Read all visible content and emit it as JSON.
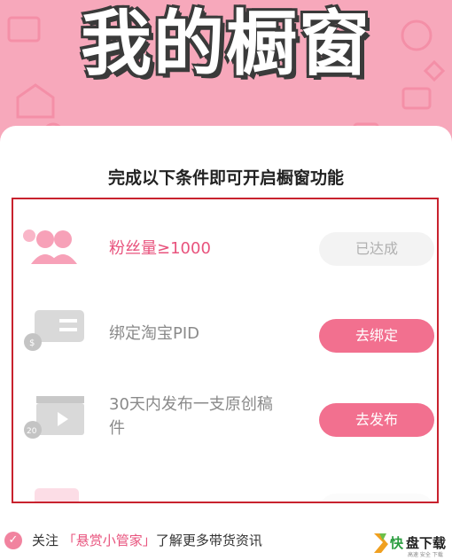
{
  "banner": {
    "title": "我的橱窗"
  },
  "heading": "完成以下条件即可开启橱窗功能",
  "conditions": [
    {
      "label": "粉丝量≥1000",
      "button": "已达成",
      "icon": "fans-icon"
    },
    {
      "label": "绑定淘宝PID",
      "button": "去绑定",
      "icon": "id-card-icon"
    },
    {
      "label": "30天内发布一支原创稿件",
      "button": "去发布",
      "icon": "video-clapper-icon"
    }
  ],
  "footer": {
    "prefix": "关注",
    "link": "「悬赏小管家」",
    "suffix": "了解更多带货资讯"
  },
  "colors": {
    "brand_pink": "#f2708f",
    "highlight_border": "#c8222e",
    "banner_bg": "#f7a8bb"
  }
}
